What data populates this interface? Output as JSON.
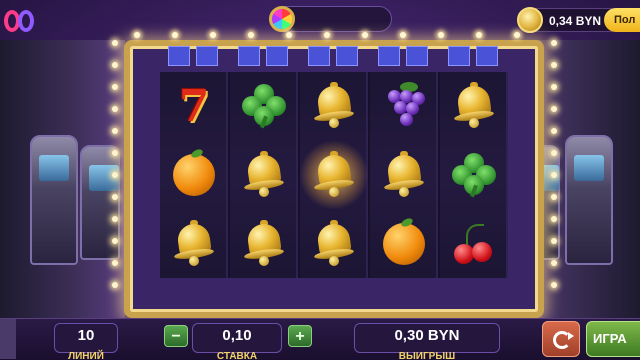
{
  "header": {
    "balance": "0,34 BYN",
    "deposit_label": "Пол"
  },
  "reels": [
    [
      "seven",
      "orange",
      "bell"
    ],
    [
      "clover",
      "bell",
      "bell"
    ],
    [
      "bell",
      "bell",
      "bell"
    ],
    [
      "grapes",
      "bell",
      "orange"
    ],
    [
      "bell",
      "clover",
      "cherries"
    ]
  ],
  "highlighted": {
    "reel": 2,
    "row": 1
  },
  "bottom": {
    "lines_value": "10",
    "lines_label": "ЛИНИЙ",
    "minus_label": "−",
    "bet_value": "0,10",
    "bet_label": "СТАВКА",
    "plus_label": "+",
    "win_value": "0,30 BYN",
    "win_label": "ВЫИГРЫШ",
    "play_label": "ИГРА"
  }
}
